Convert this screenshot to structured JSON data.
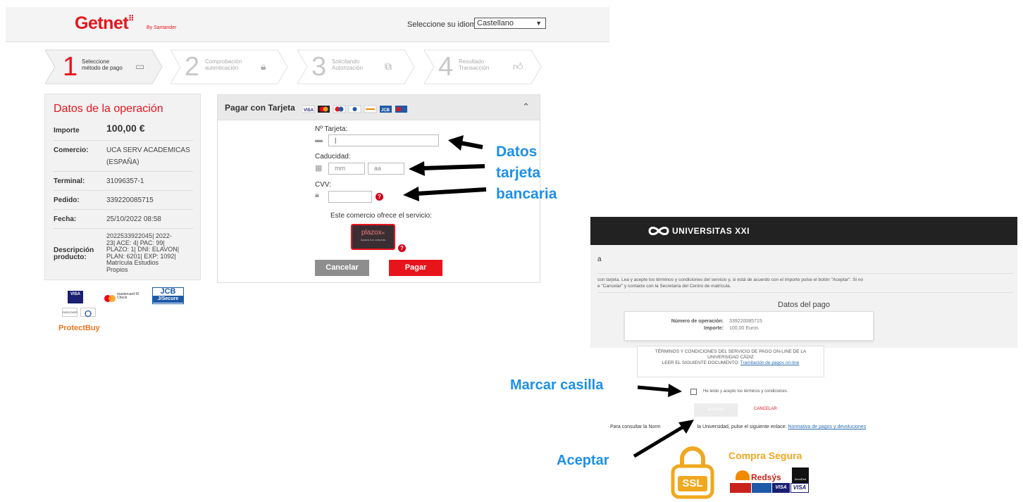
{
  "getnet": {
    "logo": "Getnet",
    "logo_mark": "⠿",
    "by_santander": "By Santander",
    "language_label": "Seleccione su idioma",
    "language_value": "Castellano",
    "steps": [
      {
        "num": "1",
        "label_1": "Seleccione",
        "label_2": "método de pago",
        "active": true
      },
      {
        "num": "2",
        "label_1": "Comprobación",
        "label_2": "autenticación",
        "active": false
      },
      {
        "num": "3",
        "label_1": "Solicitando",
        "label_2": "Autorización",
        "active": false
      },
      {
        "num": "4",
        "label_1": "Resultado",
        "label_2": "Transacción",
        "active": false
      }
    ],
    "operation": {
      "title": "Datos de la operación",
      "importe_label": "Importe",
      "importe_value": "100,00 €",
      "comercio_label": "Comercio:",
      "comercio_value_1": "UCA SERV ACADEMICAS",
      "comercio_value_2": "(ESPAÑA)",
      "terminal_label": "Terminal:",
      "terminal_value": "31096357-1",
      "pedido_label": "Pedido:",
      "pedido_value": "339220085715",
      "fecha_label": "Fecha:",
      "fecha_value": "25/10/2022 08:58",
      "descripcion_label_1": "Descripción",
      "descripcion_label_2": "producto:",
      "descripcion_lines": [
        "2022533922045| 2022-",
        "23| ACE: 4| PAC: 99|",
        "PLAZO: 1| DNI: ELAVON|",
        "PLAN: 6201| EXP: 1092|",
        "Matrícula Estudios",
        "Propios"
      ]
    },
    "brand_logos": {
      "visa": "VISA",
      "mastercard": "mastercard ID Check",
      "jcb": "JCB",
      "jsecure": "J/Secure",
      "discover": "DISCOVER",
      "protectbuy": "ProtectBuy"
    },
    "payment": {
      "title": "Pagar con Tarjeta",
      "card_number_label": "Nº Tarjeta:",
      "expiry_label": "Caducidad:",
      "mm_placeholder": "mm",
      "aa_placeholder": "aa",
      "cvv_label": "CVV:",
      "service_text": "Este comercio ofrece el servicio:",
      "plazox": "plazox",
      "cancel_label": "Cancelar",
      "pay_label": "Pagar"
    }
  },
  "annotations": {
    "datos_1": "Datos",
    "datos_2": "tarjeta",
    "datos_3": "bancaria",
    "marcar": "Marcar casilla",
    "aceptar": "Aceptar",
    "accent_color": "#1e90e8"
  },
  "universitas": {
    "logo_text": "UNIVERSITAS XXI",
    "heading_fragment": "a",
    "note_line_1": "con tarjeta. Lea y acepte los términos y condiciones del servicio y, si está de acuerdo con el importe pulse el botón \"Aceptar\". Si no",
    "note_line_2": "e \"Cancelar\" y contacte con la Secretaría del Centro de matrícula.",
    "datos_pago_title": "Datos del pago",
    "num_operacion_label": "Número de operación:",
    "num_operacion_value": "339220085715",
    "importe_label": "Importe:",
    "importe_value": "100,00 Euros",
    "terms_line_1": "TÉRMINOS Y CONDICIONES DEL SERVICIO DE PAGO ON-LINE DE LA",
    "terms_line_2": "UNIVERSIDAD CÁDIZ",
    "terms_line_3": "LEER EL SIGUIENTE DOCUMENTO: ",
    "terms_link": "Tramitación de pagos on-line",
    "checkbox_label": "He leído y acepto los términos y condiciones.",
    "accept_button": "ACEPTAR",
    "cancel_link": "CANCELAR",
    "norm_prefix": "Para consultar la Norm",
    "norm_middle": "la Universidad, pulse el siguiente enlace: ",
    "norm_link": "Normativa de pagos y devoluciones",
    "ssl": "SSL",
    "compra_segura": "Compra Segura",
    "redsys": "Redsýs",
    "servired": "ServiRed",
    "visa_1": "VISA",
    "visa_2": "VISA"
  }
}
